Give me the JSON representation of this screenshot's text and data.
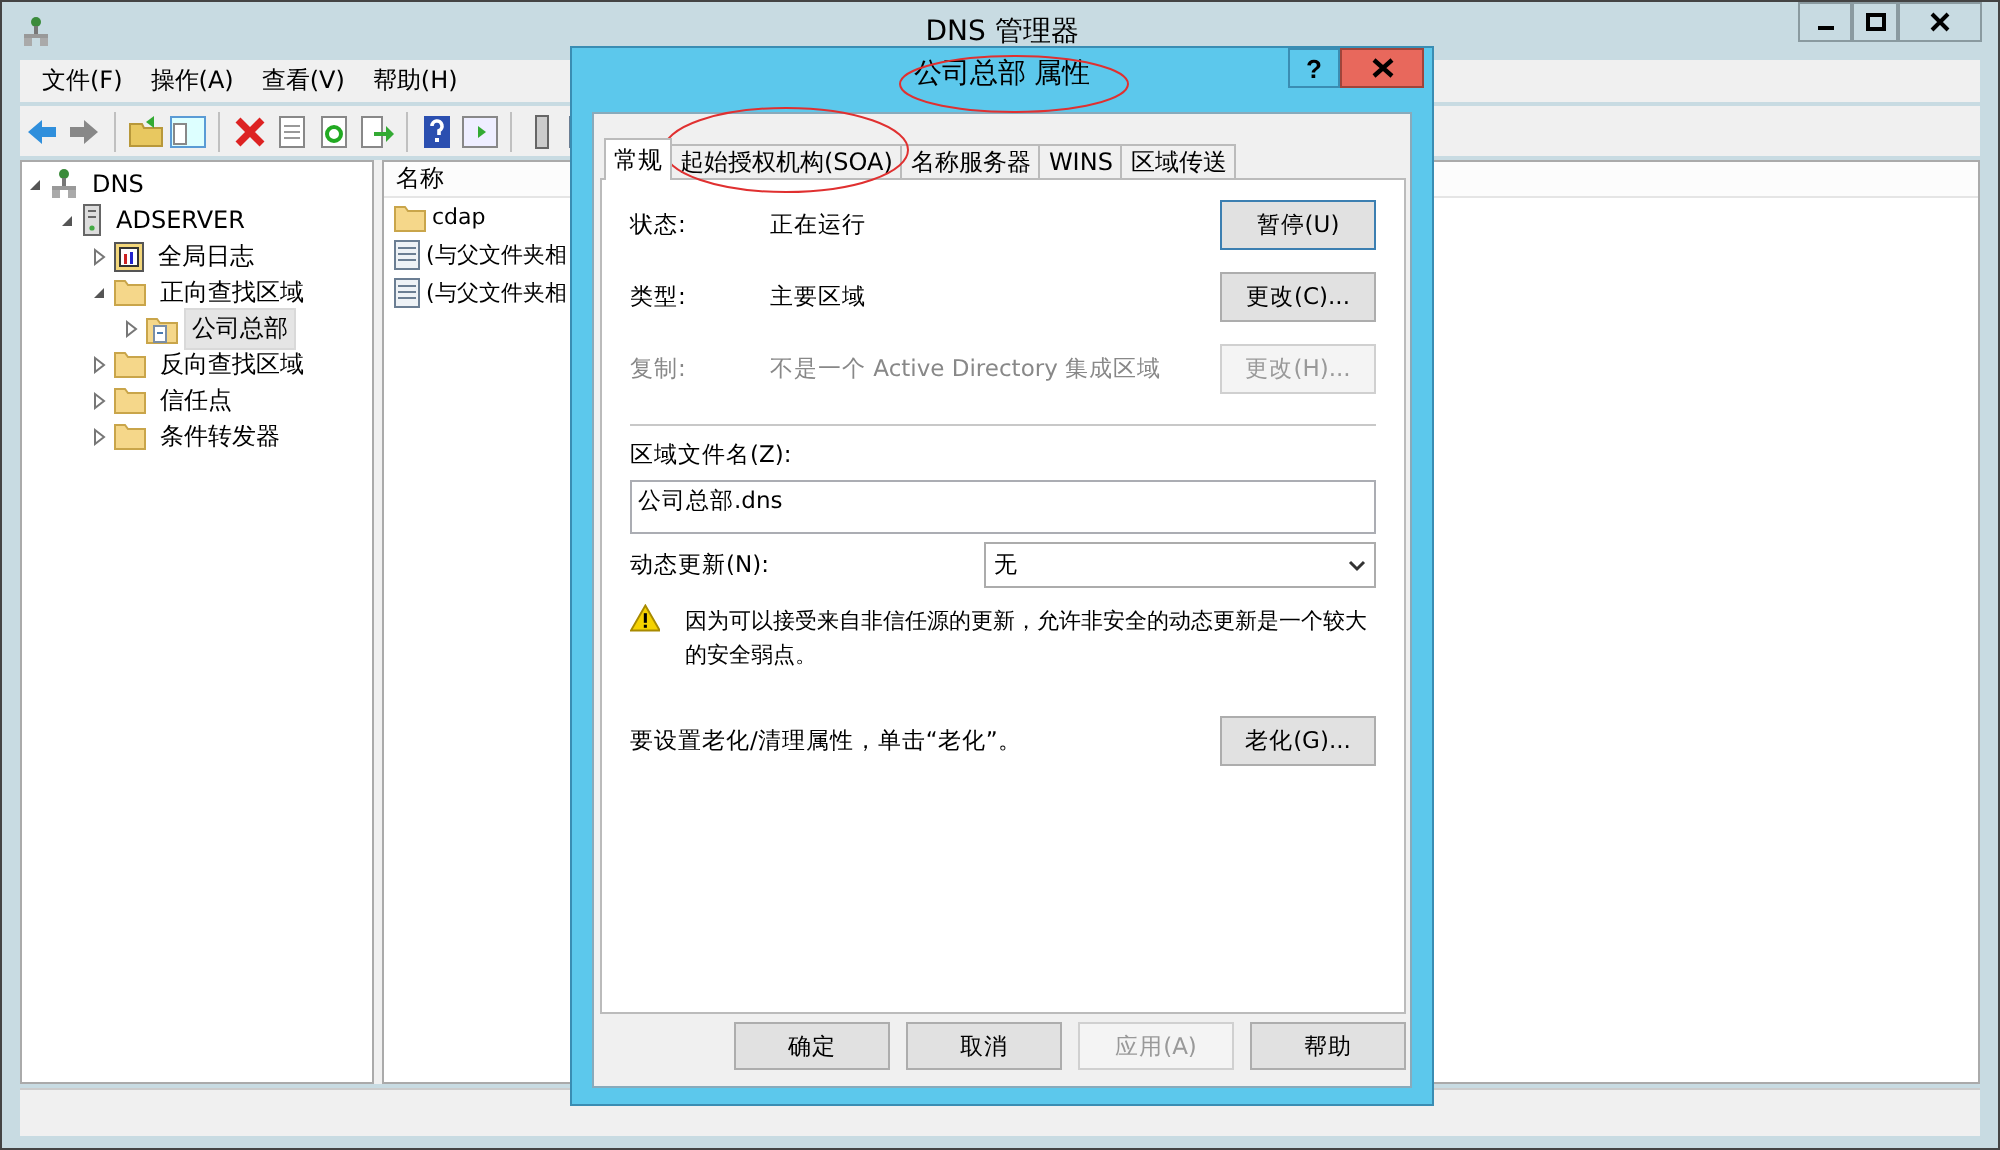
{
  "window": {
    "title": "DNS 管理器"
  },
  "menu": [
    "文件(F)",
    "操作(A)",
    "查看(V)",
    "帮助(H)"
  ],
  "tree": [
    {
      "label": "DNS",
      "kind": "root",
      "selected": false,
      "expanded": true,
      "children": [
        {
          "label": "ADSERVER",
          "kind": "server",
          "selected": false,
          "expanded": true,
          "children": [
            {
              "label": "全局日志",
              "kind": "log",
              "selected": false,
              "expanded": false
            },
            {
              "label": "正向查找区域",
              "kind": "folder",
              "selected": false,
              "expanded": true,
              "children": [
                {
                  "label": "公司总部",
                  "kind": "zone",
                  "selected": true,
                  "expanded": false
                }
              ]
            },
            {
              "label": "反向查找区域",
              "kind": "folder",
              "selected": false,
              "expanded": false
            },
            {
              "label": "信任点",
              "kind": "folder",
              "selected": false,
              "expanded": false
            },
            {
              "label": "条件转发器",
              "kind": "folder",
              "selected": false,
              "expanded": false
            }
          ]
        }
      ]
    }
  ],
  "list": {
    "columns": [
      "名称"
    ],
    "rows": [
      {
        "name": "cdap",
        "kind": "folder"
      },
      {
        "name": "(与父文件夹相",
        "kind": "record"
      },
      {
        "name": "(与父文件夹相",
        "kind": "record"
      }
    ]
  },
  "dialog": {
    "title": "公司总部 属性",
    "help_button": "?",
    "tabs": [
      {
        "label": "常规",
        "selected": true
      },
      {
        "label": "起始授权机构(SOA)",
        "selected": false
      },
      {
        "label": "名称服务器",
        "selected": false
      },
      {
        "label": "WINS",
        "selected": false
      },
      {
        "label": "区域传送",
        "selected": false
      }
    ],
    "info_rows": [
      {
        "label": "状态:",
        "value": "正在运行",
        "button": "暂停(U)",
        "disabled": false,
        "default": true
      },
      {
        "label": "类型:",
        "value": "主要区域",
        "button": "更改(C)...",
        "disabled": false,
        "default": false
      },
      {
        "label": "复制:",
        "value": "不是一个 Active Directory 集成区域",
        "button": "更改(H)...",
        "disabled": true,
        "default": false
      }
    ],
    "zone_file": {
      "label": "区域文件名(Z):",
      "value": "公司总部.dns"
    },
    "dynamic_update": {
      "label": "动态更新(N):",
      "value": "无"
    },
    "warning": "因为可以接受来自非信任源的更新，允许非安全的动态更新是一个较大的安全弱点。",
    "aging": {
      "text": "要设置老化/清理属性，单击“老化”。",
      "button": "老化(G)..."
    },
    "buttons": [
      {
        "label": "确定",
        "disabled": false
      },
      {
        "label": "取消",
        "disabled": false
      },
      {
        "label": "应用(A)",
        "disabled": true
      },
      {
        "label": "帮助",
        "disabled": false
      }
    ]
  }
}
